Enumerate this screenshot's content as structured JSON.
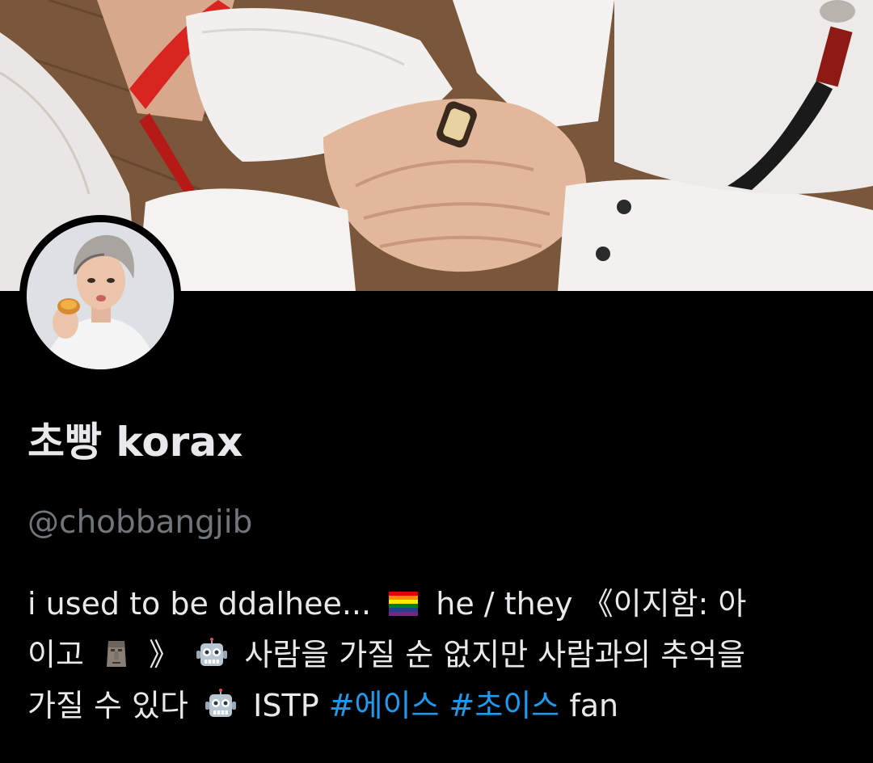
{
  "profile": {
    "display_name": "초빵 korax",
    "handle": "@chobbangjib",
    "bio": {
      "line1_a": "i used to be ddalhee...",
      "line1_b": "he / they 《이지함: 아",
      "line2_a": "이고",
      "line2_b": "》",
      "line2_c": "사람을 가질 순 없지만 사람과의 추억을",
      "line3_a": "가질 수 있다",
      "line3_b": "ISTP",
      "hashtag1": "#에이스",
      "hashtag2": "#초이스",
      "line3_c": "fan"
    },
    "emojis": [
      "rainbow-flag-icon",
      "moai-icon",
      "robot-icon",
      "robot-icon"
    ]
  },
  "colors": {
    "background": "#000000",
    "text_primary": "#e7e9ea",
    "text_secondary": "#71767b",
    "hashtag": "#1d9bf0"
  }
}
